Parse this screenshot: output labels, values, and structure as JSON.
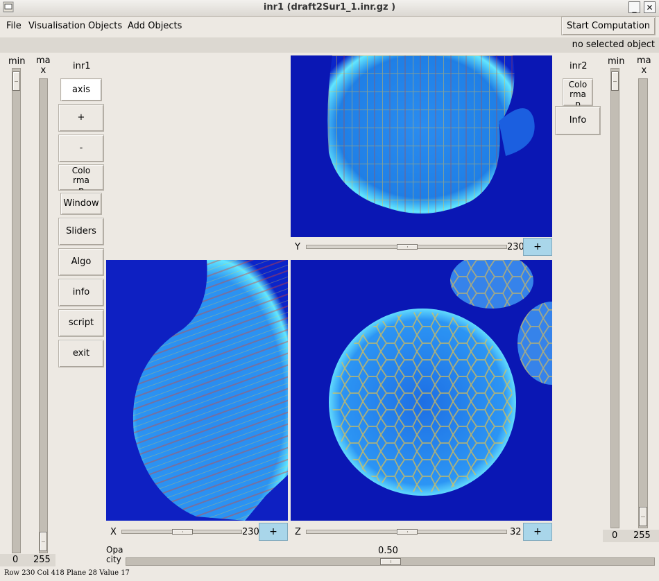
{
  "window": {
    "title": "inr1 (draft2Sur1_1.inr.gz  )",
    "minimize_glyph": "_",
    "close_glyph": "✕"
  },
  "menu": {
    "file": "File",
    "visualisation": "Visualisation",
    "objects": "Objects",
    "add_objects": "Add Objects",
    "start_computation": "Start Computation"
  },
  "selection_status": "no selected object",
  "left_sliders": {
    "min_label": "min",
    "max_label": "ma\nx",
    "min_value": "0",
    "max_value": "255",
    "min_level": 0.0,
    "max_level": 1.0
  },
  "right_sliders": {
    "min_label": "min",
    "max_label": "ma\nx",
    "min_value": "0",
    "max_value": "255",
    "min_level": 0.0,
    "max_level": 1.0
  },
  "left_panel": {
    "title": "inr1",
    "buttons": {
      "axis": "axis",
      "zoom_in": "+",
      "zoom_out": "-",
      "colormap": "Colo\nrma\np",
      "window": "Window",
      "sliders": "Sliders",
      "algo": "Algo",
      "info": "info",
      "script": "script",
      "exit": "exit"
    }
  },
  "right_panel": {
    "title": "inr2",
    "colormap": "Colo\nrma\np",
    "info": "Info"
  },
  "views": {
    "y": {
      "axis_label": "Y",
      "value": "230",
      "plus": "+"
    },
    "x": {
      "axis_label": "X",
      "value": "230",
      "plus": "+"
    },
    "z": {
      "axis_label": "Z",
      "value": "32",
      "plus": "+"
    }
  },
  "opacity": {
    "label": "Opa\ncity",
    "value": "0.50",
    "level": 0.5
  },
  "status_bar": "Row 230 Col 418 Plane  28 Value  17",
  "colors": {
    "background": "#ede9e3",
    "image_background": "#0a17b4",
    "plus_button": "#a9d6ea"
  }
}
